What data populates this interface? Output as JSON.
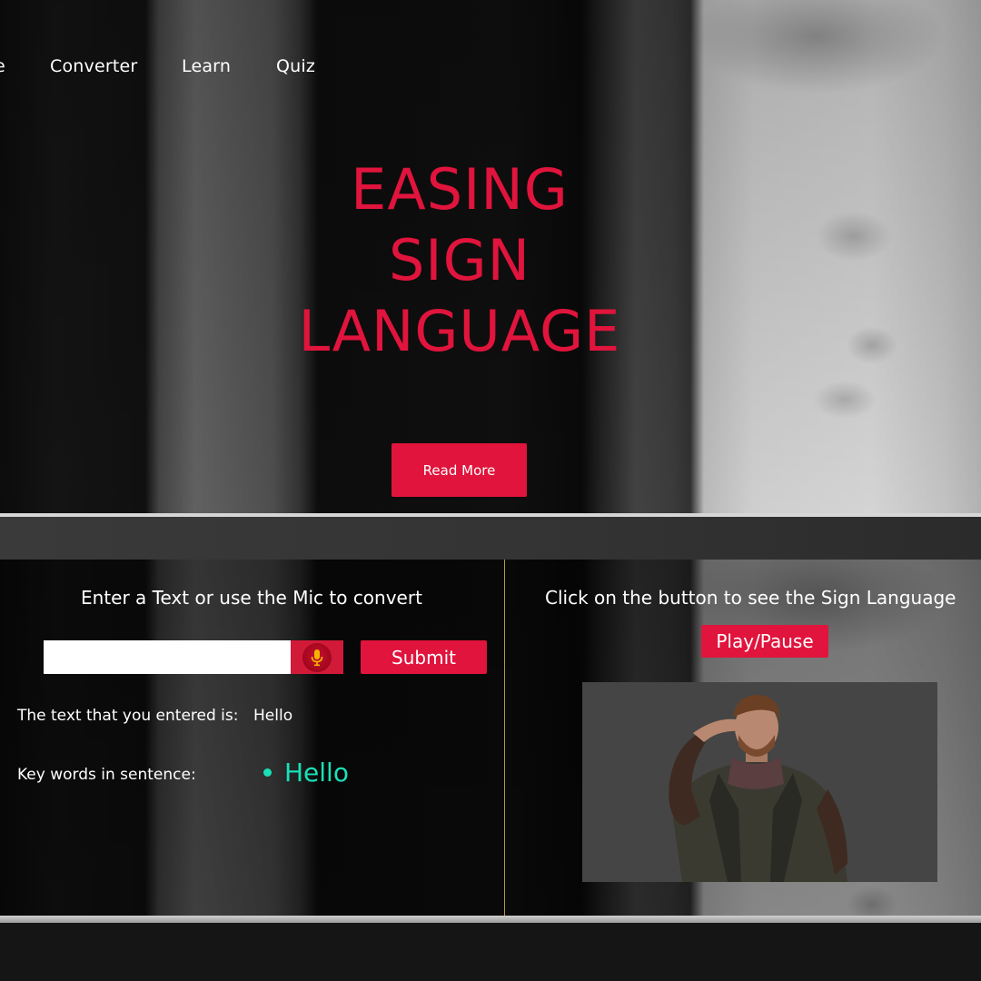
{
  "nav": {
    "items": [
      "e",
      "Converter",
      "Learn",
      "Quiz"
    ]
  },
  "hero": {
    "title_lines": [
      "EASING",
      "SIGN",
      "LANGUAGE"
    ],
    "read_more_label": "Read More"
  },
  "converter": {
    "left_heading": "Enter a Text or use the Mic to convert",
    "input_value": "",
    "mic_icon": "microphone-icon",
    "submit_label": "Submit",
    "entered_text_label": "The text that you entered is:",
    "entered_text_value": "Hello",
    "keywords_label": "Key words in sentence:",
    "keywords": [
      "Hello"
    ],
    "right_heading": "Click on the button to see the Sign Language",
    "play_pause_label": "Play/Pause",
    "avatar": "signing-avatar-figure"
  },
  "colors": {
    "accent": "#e0143c",
    "keyword": "#19e0b8",
    "divider": "#b49a3a"
  }
}
